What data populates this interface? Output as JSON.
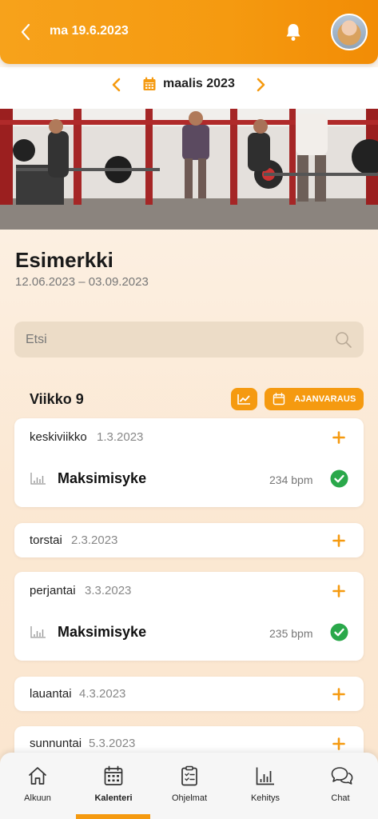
{
  "header": {
    "date": "ma 19.6.2023",
    "icons": {
      "back": "chevron-left-icon",
      "bell": "bell-icon",
      "avatar": "user-avatar"
    }
  },
  "month_nav": {
    "label": "maalis 2023",
    "icons": {
      "prev": "chevron-left-icon",
      "next": "chevron-right-icon",
      "calendar": "calendar-icon"
    }
  },
  "program": {
    "title": "Esimerkki",
    "dates": "12.06.2023 – 03.09.2023"
  },
  "search": {
    "placeholder": "Etsi"
  },
  "week": {
    "label": "Viikko 9",
    "booking_label": "AJANVARAUS"
  },
  "days": [
    {
      "name": "keskiviikko",
      "date": "1.3.2023",
      "entry": {
        "name": "Maksimisyke",
        "value": "234 bpm",
        "done": true
      }
    },
    {
      "name": "torstai",
      "date": "2.3.2023"
    },
    {
      "name": "perjantai",
      "date": "3.3.2023",
      "entry": {
        "name": "Maksimisyke",
        "value": "235 bpm",
        "done": true
      }
    },
    {
      "name": "lauantai",
      "date": "4.3.2023"
    },
    {
      "name": "sunnuntai",
      "date": "5.3.2023"
    }
  ],
  "nav": [
    {
      "label": "Alkuun",
      "icon": "home-icon"
    },
    {
      "label": "Kalenteri",
      "icon": "calendar-icon",
      "active": true
    },
    {
      "label": "Ohjelmat",
      "icon": "clipboard-icon"
    },
    {
      "label": "Kehitys",
      "icon": "bar-chart-icon"
    },
    {
      "label": "Chat",
      "icon": "chat-icon"
    }
  ],
  "colors": {
    "accent": "#f59a10",
    "success": "#2aa84a",
    "search_bg": "#ecdcc7"
  }
}
